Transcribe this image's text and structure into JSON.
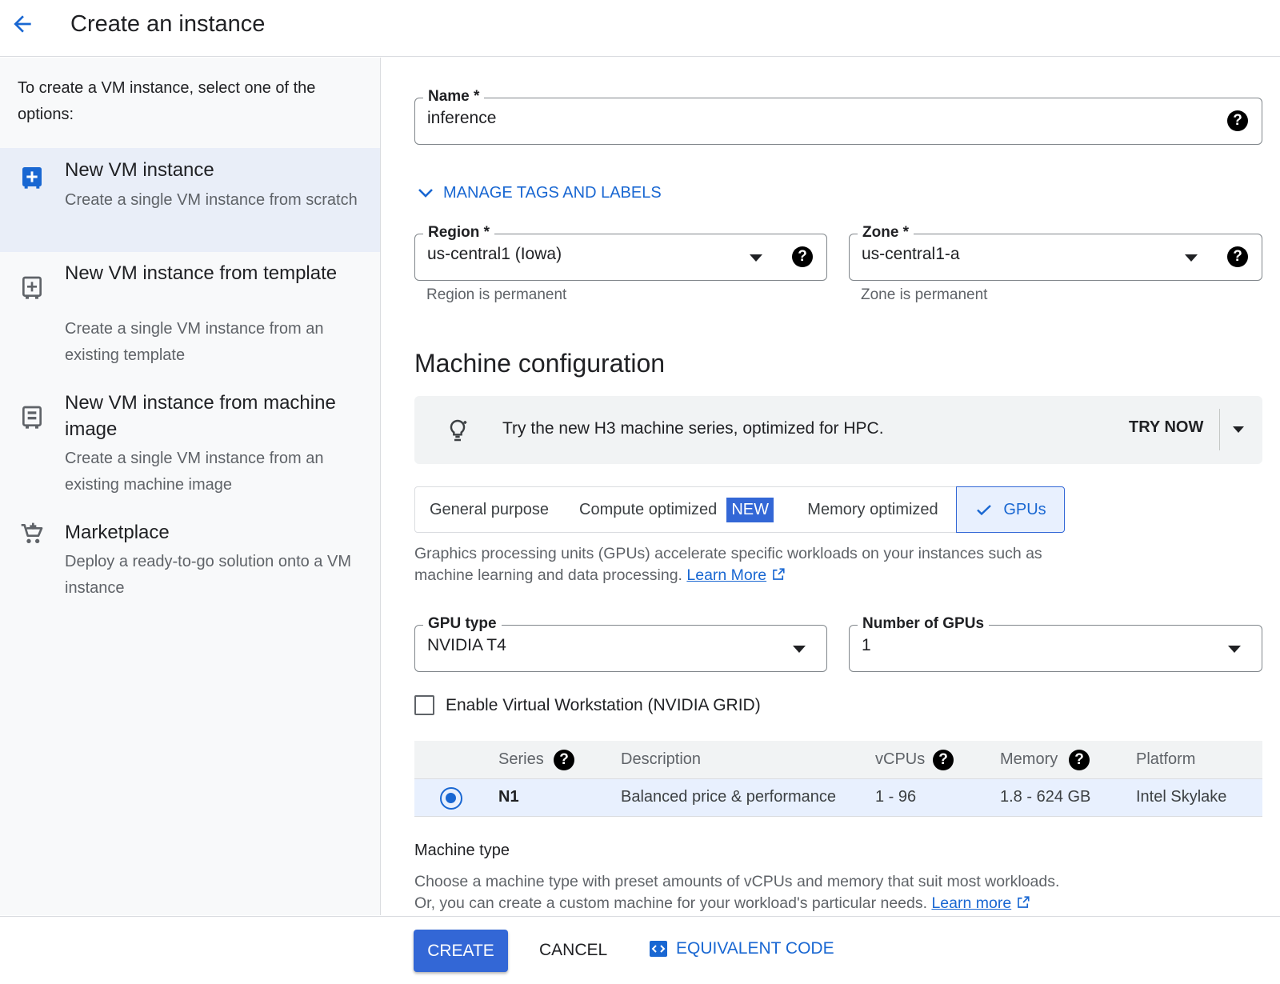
{
  "header": {
    "title": "Create an instance"
  },
  "sidebar": {
    "intro": "To create a VM instance, select one of the options:",
    "options": [
      {
        "title": "New VM instance",
        "desc": "Create a single VM instance from scratch",
        "icon": "add-box-icon",
        "selected": true
      },
      {
        "title": "New VM instance from template",
        "desc": "Create a single VM instance from an existing template",
        "icon": "template-add-icon"
      },
      {
        "title": "New VM instance from machine image",
        "desc": "Create a single VM instance from an existing machine image",
        "icon": "machine-image-icon"
      },
      {
        "title": "Marketplace",
        "desc": "Deploy a ready-to-go solution onto a VM instance",
        "icon": "cart-icon"
      }
    ]
  },
  "form": {
    "name_label": "Name *",
    "name_value": "inference",
    "manage_tags": "MANAGE TAGS AND LABELS",
    "region_label": "Region *",
    "region_value": "us-central1 (Iowa)",
    "region_hint": "Region is permanent",
    "zone_label": "Zone *",
    "zone_value": "us-central1-a",
    "zone_hint": "Zone is permanent"
  },
  "machine": {
    "title": "Machine configuration",
    "banner_text": "Try the new H3 machine series, optimized for HPC.",
    "banner_action": "TRY NOW",
    "tabs": [
      "General purpose",
      "Compute optimized",
      "Memory optimized",
      "GPUs"
    ],
    "new_badge": "NEW",
    "gpu_desc_1": "Graphics processing units (GPUs) accelerate specific workloads on your instances such as",
    "gpu_desc_2": "machine learning and data processing.",
    "learn_more": "Learn More",
    "gpu_type_label": "GPU type",
    "gpu_type_value": "NVIDIA T4",
    "gpu_count_label": "Number of GPUs",
    "gpu_count_value": "1",
    "vws_label": "Enable Virtual Workstation (NVIDIA GRID)",
    "table_headers": [
      "Series",
      "Description",
      "vCPUs",
      "Memory",
      "Platform"
    ],
    "table_row": [
      "N1",
      "Balanced price & performance",
      "1 - 96",
      "1.8 - 624 GB",
      "Intel Skylake"
    ],
    "machine_type_title": "Machine type",
    "machine_type_desc_1": "Choose a machine type with preset amounts of vCPUs and memory that suit most workloads.",
    "machine_type_desc_2": "Or, you can create a custom machine for your workload's particular needs.",
    "learn_more_2": "Learn more"
  },
  "footer": {
    "create": "CREATE",
    "cancel": "CANCEL",
    "equivalent_code": "EQUIVALENT CODE"
  },
  "colors": {
    "accent": "#1967d2",
    "button": "#3367d6"
  }
}
